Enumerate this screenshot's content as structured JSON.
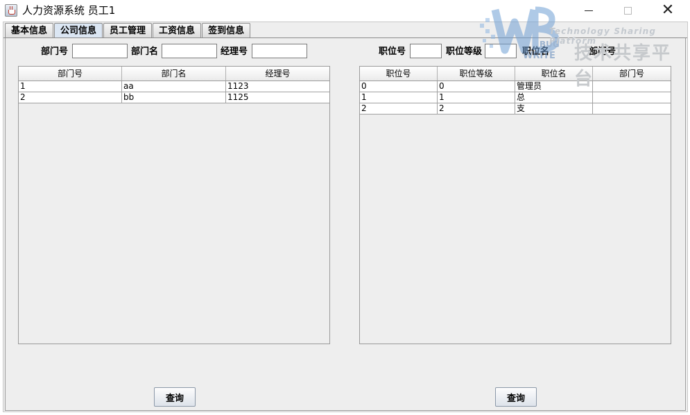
{
  "window": {
    "title": "人力资源系统 员工1"
  },
  "tabs": [
    {
      "label": "基本信息",
      "active": false
    },
    {
      "label": "公司信息",
      "active": true
    },
    {
      "label": "员工管理",
      "active": false
    },
    {
      "label": "工资信息",
      "active": false
    },
    {
      "label": "签到信息",
      "active": false
    }
  ],
  "dept_filter": {
    "dept_id_label": "部门号",
    "dept_name_label": "部门名",
    "manager_id_label": "经理号",
    "dept_id_value": "",
    "dept_name_value": "",
    "manager_id_value": ""
  },
  "position_filter": {
    "position_id_label": "职位号",
    "position_level_label": "职位等级",
    "position_name_label": "职位名",
    "dept_id_label": "部门号",
    "position_id_value": "",
    "position_level_value": ""
  },
  "dept_table": {
    "columns": [
      "部门号",
      "部门名",
      "经理号"
    ],
    "rows": [
      [
        "1",
        "aa",
        "1123"
      ],
      [
        "2",
        "bb",
        "1125"
      ]
    ]
  },
  "position_table": {
    "columns": [
      "职位号",
      "职位等级",
      "职位名",
      "部门号"
    ],
    "rows": [
      [
        "0",
        "0",
        "管理员",
        ""
      ],
      [
        "1",
        "1",
        "总",
        ""
      ],
      [
        "2",
        "2",
        "支",
        ""
      ]
    ]
  },
  "buttons": {
    "dept_query_label": "查询",
    "position_query_label": "查询"
  },
  "watermark": {
    "logo_text": "WRITE",
    "english_text": "Technology Sharing Platform",
    "chinese_text": "技术共享平台"
  },
  "colors": {
    "active_tab": "#dbe6f3",
    "panel_background": "#eeeeee",
    "button_border": "#8b98a8"
  }
}
